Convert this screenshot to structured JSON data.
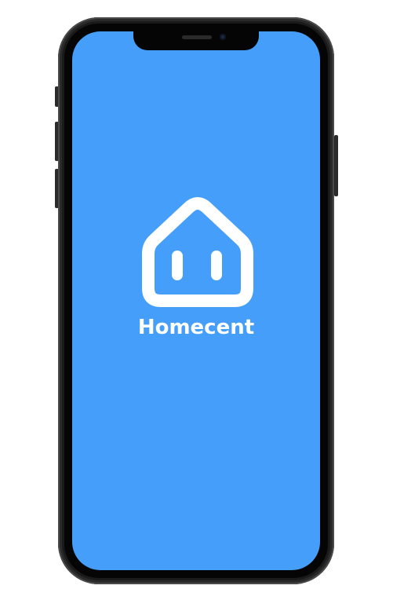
{
  "app": {
    "name": "Homecent",
    "logo_icon": "house-icon"
  },
  "colors": {
    "background": "#459ef9",
    "foreground": "#ffffff",
    "device_frame": "#1a1a1a"
  }
}
